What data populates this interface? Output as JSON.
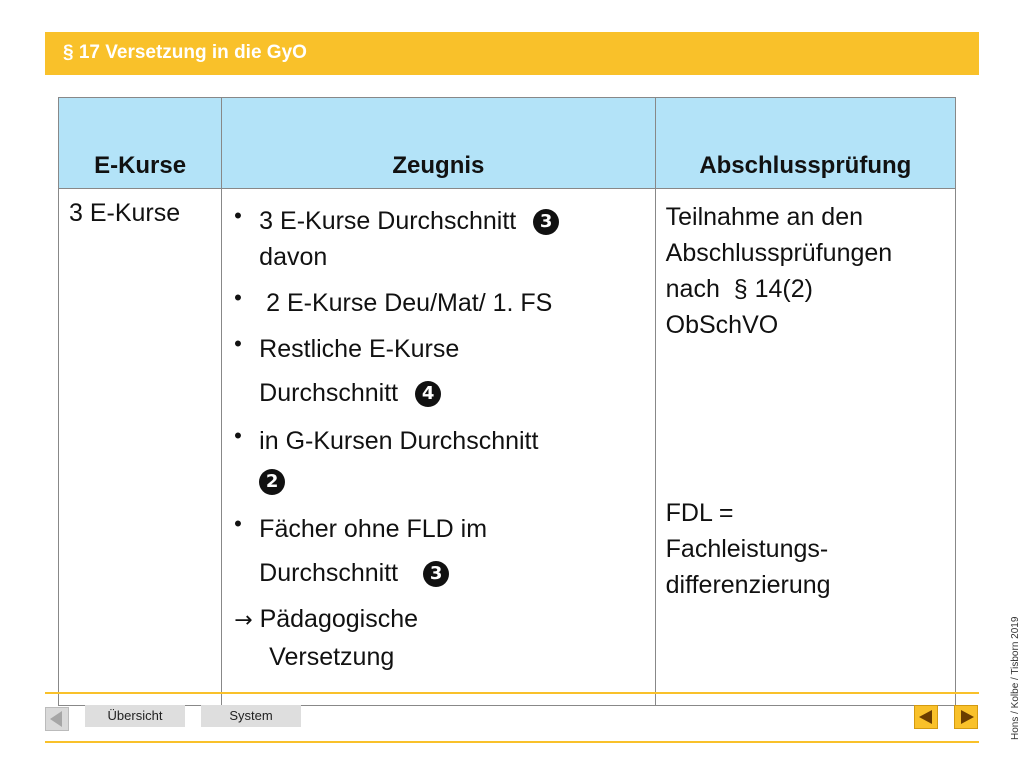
{
  "header": {
    "title": "§  17 Versetzung in die GyO"
  },
  "table": {
    "headers": [
      "E-Kurse",
      "Zeugnis",
      "Abschlussprüfung"
    ],
    "col1": "3 E-Kurse",
    "zeugnis": [
      {
        "bullet": "•",
        "lines": [
          "3 E-Kurse Durchschnitt",
          "davon"
        ],
        "badge": "3"
      },
      {
        "bullet": "•",
        "lines": [
          " 2 E-Kurse Deu/Mat/ 1. FS"
        ]
      },
      {
        "bullet": "•",
        "lines": [
          "Restliche E-Kurse",
          "Durchschnitt"
        ],
        "badge": "4"
      },
      {
        "bullet": "•",
        "lines": [
          "in G-Kursen Durchschnitt"
        ],
        "badge": "2"
      },
      {
        "bullet": "•",
        "lines": [
          "Fächer ohne FLD im",
          "Durchschnitt"
        ],
        "badge": "3"
      }
    ],
    "conclusion": {
      "arrow": "→",
      "line1": "Pädagogische",
      "line2": "Versetzung"
    },
    "abschluss": {
      "block1": [
        "Teilnahme an den",
        "Abschlussprüfungen",
        "nach  § 14(2)",
        "ObSchVO"
      ],
      "block2": [
        "FDL =",
        "Fachleistungs-",
        "differenzierung"
      ]
    }
  },
  "footer": {
    "tab1": "Übersicht",
    "tab2": "System",
    "credit": "Hons / Kolbe / Tisborn 2019"
  },
  "colors": {
    "accent": "#f9c12a",
    "header_bg": "#b3e3f8"
  },
  "icons": [
    "nav-left-disabled-icon",
    "prev-arrow-icon",
    "next-arrow-icon",
    "number-badge-icon"
  ]
}
